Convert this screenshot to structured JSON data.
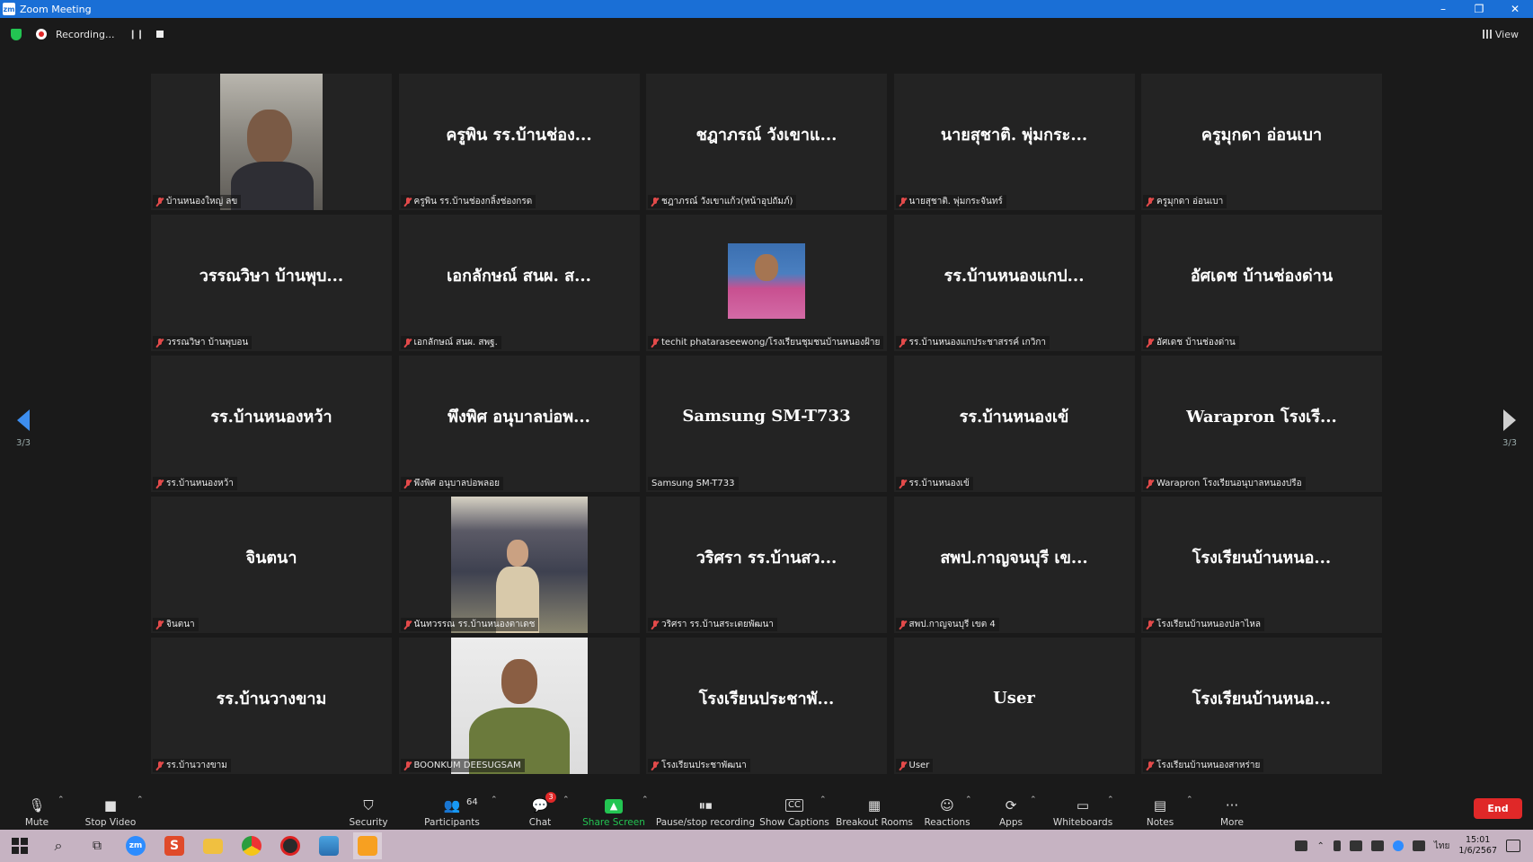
{
  "window": {
    "title": "Zoom Meeting",
    "logo_text": "zm",
    "minimize": "–",
    "restore": "❐",
    "close": "✕"
  },
  "topbar": {
    "recording_text": "Recording...",
    "pause_glyph": "❙❙",
    "view_label": "View"
  },
  "tiles": [
    {
      "big": "",
      "label": "บ้านหนองใหญ่ ลข",
      "photo": "car"
    },
    {
      "big": "ครูพิน รร.บ้านช่อง...",
      "label": "ครูพิน รร.บ้านช่องกลิ้งช่องกรด"
    },
    {
      "big": "ชฎาภรณ์ วังเขาแ...",
      "label": "ชฎาภรณ์ วังเขาแก้ว(หน้าอุปถัมภ์)"
    },
    {
      "big": "นายสุชาติ. พุ่มกระ...",
      "label": "นายสุชาติ. พุ่มกระจันทร์"
    },
    {
      "big": "ครูมุกดา อ่อนเบา",
      "label": "ครูมุกดา อ่อนเบา"
    },
    {
      "big": "วรรณวิษา บ้านพุบ...",
      "label": "วรรณวิษา บ้านพุบอน"
    },
    {
      "big": "เอกลักษณ์ สนผ. ส...",
      "label": "เอกลักษณ์ สนผ. สพฐ."
    },
    {
      "big": "",
      "label": "techit phataraseewong/โรงเรียนชุมชนบ้านหนองฝ้าย",
      "photo": "small"
    },
    {
      "big": "รร.บ้านหนองแกป...",
      "label": "รร.บ้านหนองแกประชาสรรค์ เกวิกา"
    },
    {
      "big": "อัศเดช บ้านช่องด่าน",
      "label": "อัศเดช บ้านช่องด่าน"
    },
    {
      "big": "รร.บ้านหนองหว้า",
      "label": "รร.บ้านหนองหว้า"
    },
    {
      "big": "พึงพิศ อนุบาลบ่อพ...",
      "label": "พึงพิศ อนุบาลบ่อพลอย"
    },
    {
      "big": "Samsung SM-T733",
      "label": "Samsung SM-T733",
      "unmuted": true
    },
    {
      "big": "รร.บ้านหนองเข้",
      "label": "รร.บ้านหนองเข้"
    },
    {
      "big": "Warapron โรงเรี...",
      "label": "Warapron โรงเรียนอนุบาลหนองปรือ"
    },
    {
      "big": "จินตนา",
      "label": "จินตนา"
    },
    {
      "big": "",
      "label": "นันทวรรณ รร.บ้านหนองตาเดช",
      "photo": "woman"
    },
    {
      "big": "วริศรา รร.บ้านสว...",
      "label": "วริศรา รร.บ้านสระเตยพัฒนา"
    },
    {
      "big": "สพป.กาญจนบุรี เข...",
      "label": "สพป.กาญจนบุรี เขต 4"
    },
    {
      "big": "โรงเรียนบ้านหนอ...",
      "label": "โรงเรียนบ้านหนองปลาไหล"
    },
    {
      "big": "รร.บ้านวางขาม",
      "label": "รร.บ้านวางขาม"
    },
    {
      "big": "",
      "label": "BOONKUM DEESUGSAM",
      "photo": "man"
    },
    {
      "big": "โรงเรียนประชาพั...",
      "label": "โรงเรียนประชาพัฒนา"
    },
    {
      "big": "User",
      "label": "User"
    },
    {
      "big": "โรงเรียนบ้านหนอ...",
      "label": "โรงเรียนบ้านหนองสาหร่าย"
    }
  ],
  "pager": {
    "left": "3/3",
    "right": "3/3"
  },
  "toolbar": {
    "mute": "Mute",
    "stop_video": "Stop Video",
    "security": "Security",
    "participants": "Participants",
    "participants_count": "64",
    "chat": "Chat",
    "chat_badge": "3",
    "share_screen": "Share Screen",
    "pause_recording": "Pause/stop recording",
    "show_captions": "Show Captions",
    "breakout_rooms": "Breakout Rooms",
    "reactions": "Reactions",
    "apps": "Apps",
    "whiteboards": "Whiteboards",
    "notes": "Notes",
    "more": "More",
    "end": "End"
  },
  "taskbar": {
    "zoom_label": "zm",
    "s_label": "S",
    "lang": "ไทย",
    "time": "15:01",
    "date": "1/6/2567"
  },
  "colors": {
    "titlebar": "#1a6fd6",
    "share_green": "#23c552",
    "end_red": "#e02828",
    "taskbar": "#c6b3c2"
  }
}
